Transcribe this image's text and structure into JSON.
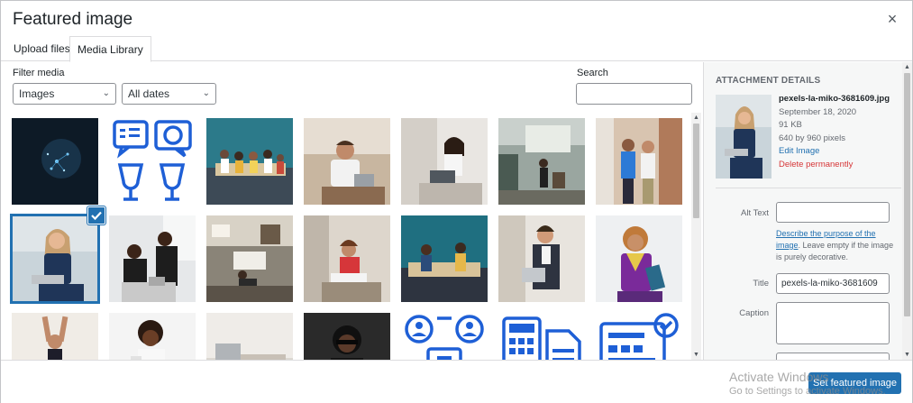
{
  "modal": {
    "title": "Featured image",
    "close_glyph": "×"
  },
  "tabs": [
    {
      "label": "Upload files"
    },
    {
      "label": "Media Library",
      "active": true
    }
  ],
  "filters": {
    "label": "Filter media",
    "type_selected": "Images",
    "date_selected": "All dates",
    "search_label": "Search",
    "search_value": ""
  },
  "grid": {
    "items": [
      {
        "kind": "photo",
        "subject": "dark-network"
      },
      {
        "kind": "icon",
        "subject": "chat-price-glasses-icon"
      },
      {
        "kind": "photo",
        "subject": "team-on-sofa"
      },
      {
        "kind": "photo",
        "subject": "man-laptop-smiling"
      },
      {
        "kind": "photo",
        "subject": "woman-laptop"
      },
      {
        "kind": "photo",
        "subject": "meeting-room"
      },
      {
        "kind": "photo",
        "subject": "colleagues-walking"
      },
      {
        "kind": "photo",
        "subject": "woman-sitting-laptop",
        "selected": true
      },
      {
        "kind": "photo",
        "subject": "women-talking"
      },
      {
        "kind": "photo",
        "subject": "living-room"
      },
      {
        "kind": "photo",
        "subject": "woman-red-laptop"
      },
      {
        "kind": "photo",
        "subject": "couple-sofa"
      },
      {
        "kind": "photo",
        "subject": "businessman-tablet"
      },
      {
        "kind": "photo",
        "subject": "woman-purple-folder"
      },
      {
        "kind": "photo",
        "subject": "woman-arms-up"
      },
      {
        "kind": "photo",
        "subject": "woman-portrait"
      },
      {
        "kind": "photo",
        "subject": "laptop-desk"
      },
      {
        "kind": "photo",
        "subject": "woman-dark"
      },
      {
        "kind": "icon",
        "subject": "network-people-icon"
      },
      {
        "kind": "icon",
        "subject": "calculator-document-icon"
      },
      {
        "kind": "icon",
        "subject": "machine-check-icon"
      }
    ]
  },
  "details": {
    "heading": "ATTACHMENT DETAILS",
    "filename": "pexels-la-miko-3681609.jpg",
    "date": "September 18, 2020",
    "size": "91 KB",
    "dimensions": "640 by 960 pixels",
    "edit_link": "Edit Image",
    "delete_link": "Delete permanently",
    "alt_label": "Alt Text",
    "alt_value": "",
    "help_link": "Describe the purpose of the image",
    "help_rest": ". Leave empty if the image is purely decorative.",
    "title_label": "Title",
    "title_value": "pexels-la-miko-3681609",
    "caption_label": "Caption",
    "caption_value": ""
  },
  "footer": {
    "button": "Set featured image"
  },
  "watermark": {
    "line1": "Activate Windows",
    "line2": "Go to Settings to activate Windows."
  },
  "colors": {
    "accent": "#2271b1",
    "danger": "#d63638",
    "icon_blue": "#1e5fd6"
  }
}
